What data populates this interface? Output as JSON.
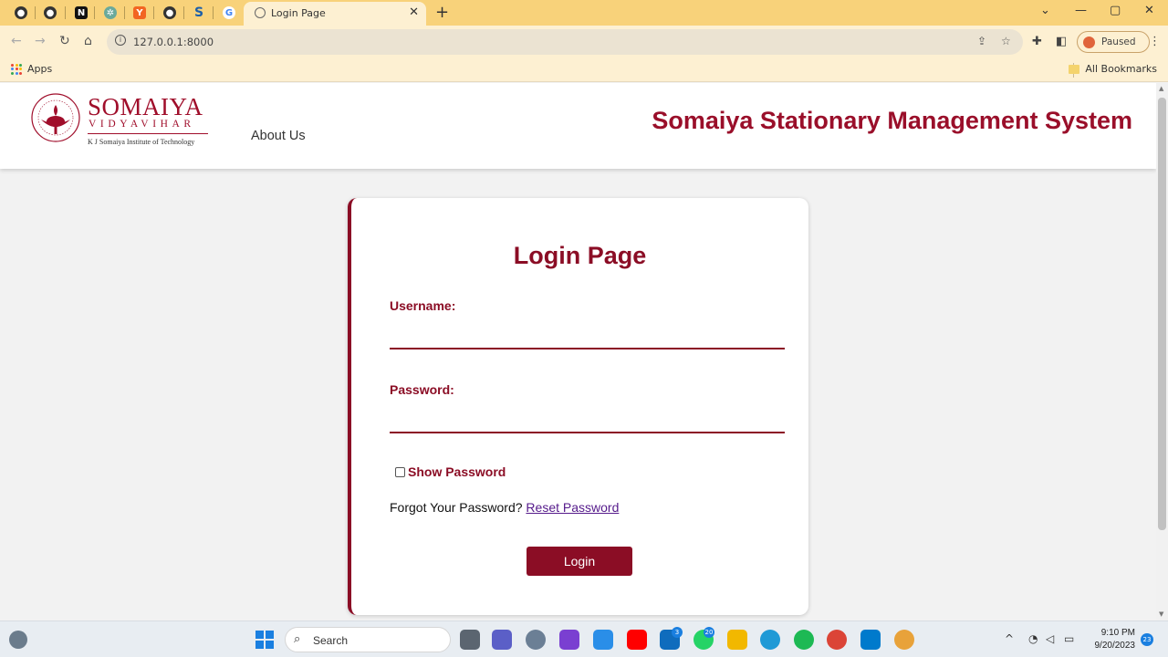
{
  "browser": {
    "active_tab_title": "Login Page",
    "url": "127.0.0.1:8000",
    "profile_status": "Paused",
    "bookmarks": {
      "apps_label": "Apps",
      "all_bookmarks_label": "All Bookmarks"
    },
    "pinned_tabs": [
      "github-icon",
      "github-icon",
      "notion-icon",
      "chatgpt-icon",
      "y-combinator-icon",
      "github-icon",
      "s-app-icon",
      "google-icon"
    ]
  },
  "site": {
    "logo": {
      "name": "SOMAIYA",
      "sub": "VIDYAVIHAR",
      "institute": "K J Somaiya Institute of Technology"
    },
    "nav": {
      "about": "About Us"
    },
    "title": "Somaiya Stationary Management System"
  },
  "login": {
    "heading": "Login Page",
    "username_label": "Username:",
    "username_value": "",
    "password_label": "Password:",
    "password_value": "",
    "show_password_label": "Show Password",
    "forgot_text": "Forgot Your Password?",
    "reset_link": "Reset Password",
    "submit_label": "Login"
  },
  "taskbar": {
    "search_placeholder": "Search",
    "time": "9:10 PM",
    "date": "9/20/2023",
    "notification_count": "23",
    "mail_badge": "3",
    "whatsapp_badge": "20"
  },
  "colors": {
    "brand": "#8b0d25",
    "tab_strip": "#f8d27a",
    "toolbar": "#fdf0d2"
  }
}
